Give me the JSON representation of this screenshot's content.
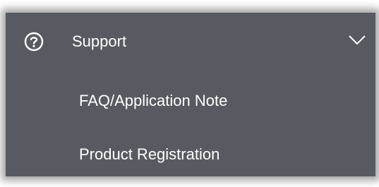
{
  "menu": {
    "header": {
      "label": "Support",
      "icon": "help-circle-icon",
      "expand_icon": "chevron-down-icon"
    },
    "items": [
      {
        "label": "FAQ/Application Note"
      },
      {
        "label": "Product Registration"
      }
    ]
  },
  "colors": {
    "panel_background": "#575b61",
    "text": "#ffffff"
  }
}
